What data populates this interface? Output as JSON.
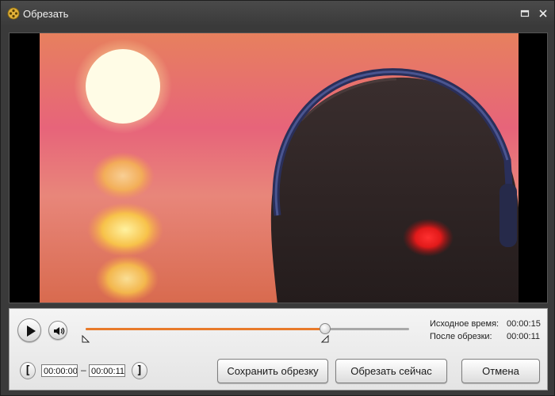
{
  "window": {
    "title": "Обрезать",
    "app_icon": "film-reel-icon",
    "controls": {
      "maximize_icon": "maximize-icon",
      "close_icon": "close-icon"
    }
  },
  "video": {
    "content": "video-frame-preview"
  },
  "playback": {
    "play_icon": "play-icon",
    "volume_icon": "speaker-icon",
    "position_fraction": 0.74,
    "trim_start_fraction": 0.0,
    "trim_end_fraction": 0.74
  },
  "info": {
    "original_label": "Исходное время:",
    "original_value": "00:00:15",
    "after_label": "После обрезки:",
    "after_value": "00:00:11"
  },
  "trim": {
    "start_value": "00:00:00",
    "end_value": "00:00:11",
    "separator": "–",
    "set_start_icon": "bracket-left-icon",
    "set_end_icon": "bracket-right-icon"
  },
  "buttons": {
    "save": "Сохранить обрезку",
    "trim_now": "Обрезать сейчас",
    "cancel": "Отмена"
  },
  "colors": {
    "accent": "#e87a2a",
    "window_bg": "#3a3a3a"
  }
}
